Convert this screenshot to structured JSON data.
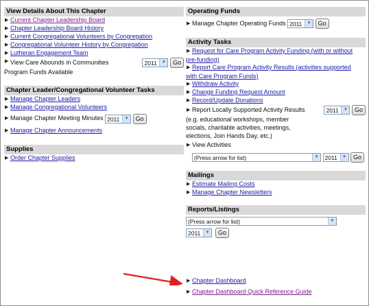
{
  "left": {
    "view_details": {
      "header": "View Details About This Chapter",
      "links": [
        "Current Chapter Leadership Board",
        "Chapter Leadership Board History",
        "Current Congregational Volunteers by Congregation",
        "Congregational Volunteer History by Congregation",
        "Lutheran Engagement Team"
      ],
      "care_abounds_label": "View Care Abounds in Communities",
      "care_abounds_year": "2011",
      "care_abounds_go": "Go",
      "care_abounds_label2": "Program Funds Available"
    },
    "leader_tasks": {
      "header": "Chapter Leader/Congregational Volunteer Tasks",
      "links": [
        "Manage Chapter Leaders",
        "Manage Congregational Volunteers"
      ],
      "minutes_label": "Manage Chapter Meeting Minutes",
      "minutes_year": "2011",
      "minutes_go": "Go",
      "announcements": "Manage Chapter Announcements"
    },
    "supplies": {
      "header": "Supplies",
      "order": "Order Chapter Supplies"
    }
  },
  "right": {
    "operating_funds": {
      "header": "Operating Funds",
      "label": "Manage Chapter Operating Funds",
      "year": "2011",
      "go": "Go"
    },
    "activity_tasks": {
      "header": "Activity Tasks",
      "request_1": "Request for Care Program Activity Funding (with or without",
      "request_2": "pre-funding)",
      "report_1": "Report Care Program Activity Results (activities supported",
      "report_2": "with Care Program Funds)",
      "withdraw": "Withdraw Activity",
      "change": "Change Funding Request Amount",
      "donations": "Record/Update Donations",
      "local_label": "Report Locally Supported Activity Results",
      "local_year": "2011",
      "local_go": "Go",
      "local_desc_1": "(e.g. educational workshops, member",
      "local_desc_2": "socials, charitable activities, meetings,",
      "local_desc_3": "elections, Join Hands Day, etc.)",
      "view_label": "View Activities",
      "view_select": "(Press arrow for list)",
      "view_year": "2011",
      "view_go": "Go"
    },
    "mailings": {
      "header": "Mailings",
      "estimate": "Estimate Mailing Costs",
      "newsletters": "Manage Chapter Newsletters"
    },
    "reports": {
      "header": "Reports/Listings",
      "select": "(Press arrow for list)",
      "year": "2011",
      "go": "Go"
    },
    "dashboard": "Chapter Dashboard",
    "dashboard_guide": "Chapter Dashboard Quick Reference Guide"
  },
  "colors": {
    "link": "#1a1aa6",
    "visited": "#7a1f8a",
    "header_bg": "#d9d9d9",
    "arrow": "#e02020"
  },
  "icons": {
    "bullet": "triangle-right-icon",
    "dropdown": "chevron-down-icon",
    "pointer": "red-arrow-icon"
  }
}
